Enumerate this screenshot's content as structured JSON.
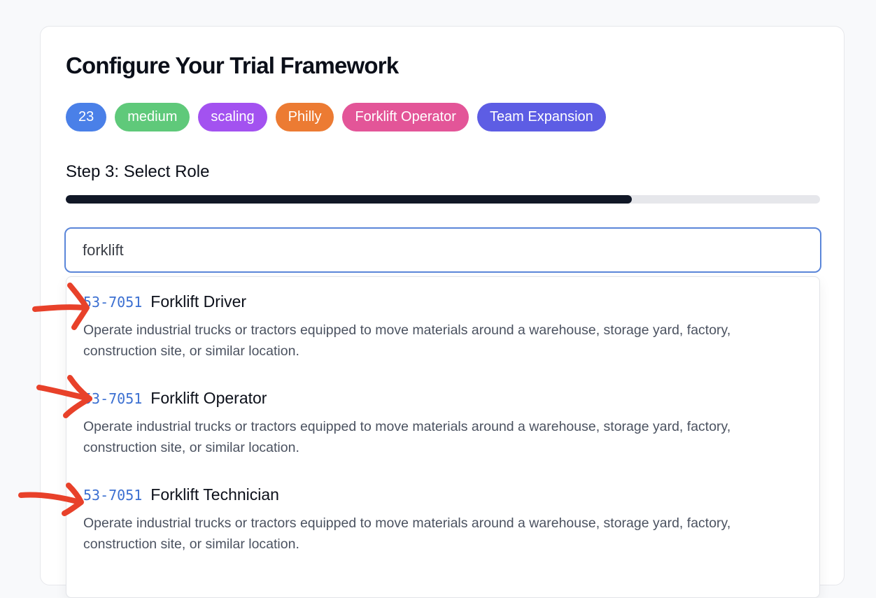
{
  "page": {
    "title": "Configure Your Trial Framework"
  },
  "tags": [
    {
      "label": "23",
      "color": "#4a80e8"
    },
    {
      "label": "medium",
      "color": "#5fc97a"
    },
    {
      "label": "scaling",
      "color": "#a352f0"
    },
    {
      "label": "Philly",
      "color": "#ec7b33"
    },
    {
      "label": "Forklift Operator",
      "color": "#e35598"
    },
    {
      "label": "Team Expansion",
      "color": "#5d5de4"
    }
  ],
  "step": {
    "label": "Step 3: Select Role",
    "progress_fraction": 0.75
  },
  "search": {
    "value": "forklift"
  },
  "results": [
    {
      "code": "53-7051",
      "title": "Forklift Driver",
      "description": "Operate industrial trucks or tractors equipped to move materials around a warehouse, storage yard, factory, construction site, or similar location."
    },
    {
      "code": "53-7051",
      "title": "Forklift Operator",
      "description": "Operate industrial trucks or tractors equipped to move materials around a warehouse, storage yard, factory, construction site, or similar location."
    },
    {
      "code": "53-7051",
      "title": "Forklift Technician",
      "description": "Operate industrial trucks or tractors equipped to move materials around a warehouse, storage yard, factory, construction site, or similar location."
    }
  ],
  "annotations": {
    "arrow_color": "#e8412a"
  }
}
